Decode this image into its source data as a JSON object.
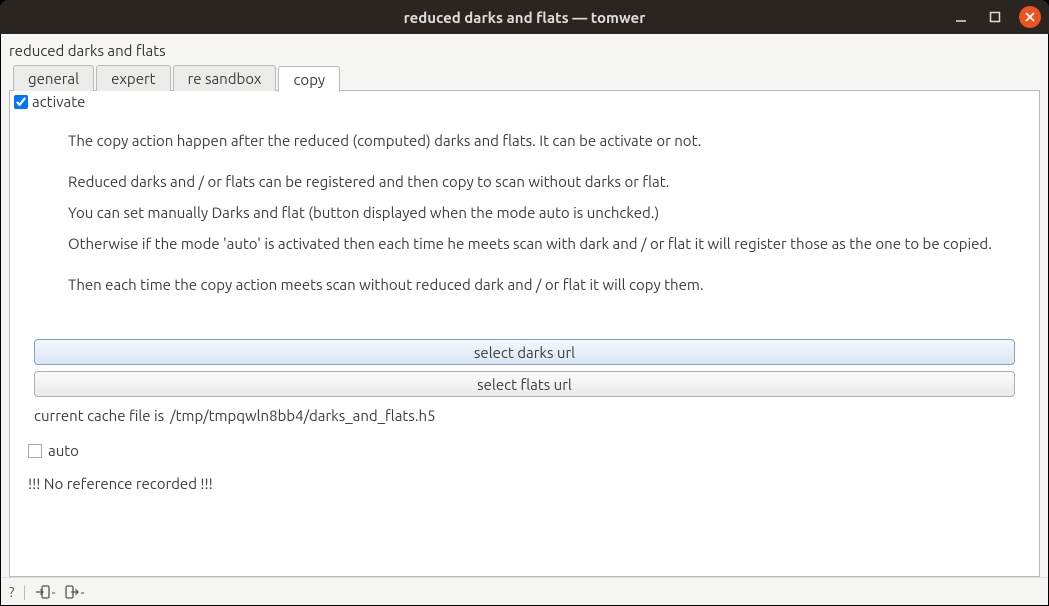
{
  "window": {
    "title": "reduced darks and flats — tomwer"
  },
  "page_title": "reduced darks and flats",
  "tabs": [
    {
      "label": "general"
    },
    {
      "label": "expert"
    },
    {
      "label": "re sandbox"
    },
    {
      "label": "copy"
    }
  ],
  "activate": {
    "label": "activate",
    "checked": true
  },
  "description": {
    "p1": "The copy action happen after the reduced (computed) darks and flats. It can be activate or not.",
    "p2": "Reduced darks and / or flats can be registered and then copy to scan without darks or flat.",
    "p3": "You can set manually Darks and flat (button displayed when the mode auto is unchcked.)",
    "p4": "Otherwise if the mode 'auto' is activated then each time he meets scan with dark and / or flat it will register those as the one to be copied.",
    "p5": "Then each time the copy action meets scan without reduced dark and / or flat it will copy them."
  },
  "buttons": {
    "select_darks": "select darks url",
    "select_flats": "select flats url"
  },
  "cache": {
    "label": "current cache file is ",
    "path": "/tmp/tmpqwln8bb4/darks_and_flats.h5"
  },
  "auto": {
    "label": "auto",
    "checked": false
  },
  "no_ref": "!!! No reference recorded !!!",
  "bottom": {
    "help": "?",
    "import_suffix": "-",
    "export_suffix": "-"
  }
}
